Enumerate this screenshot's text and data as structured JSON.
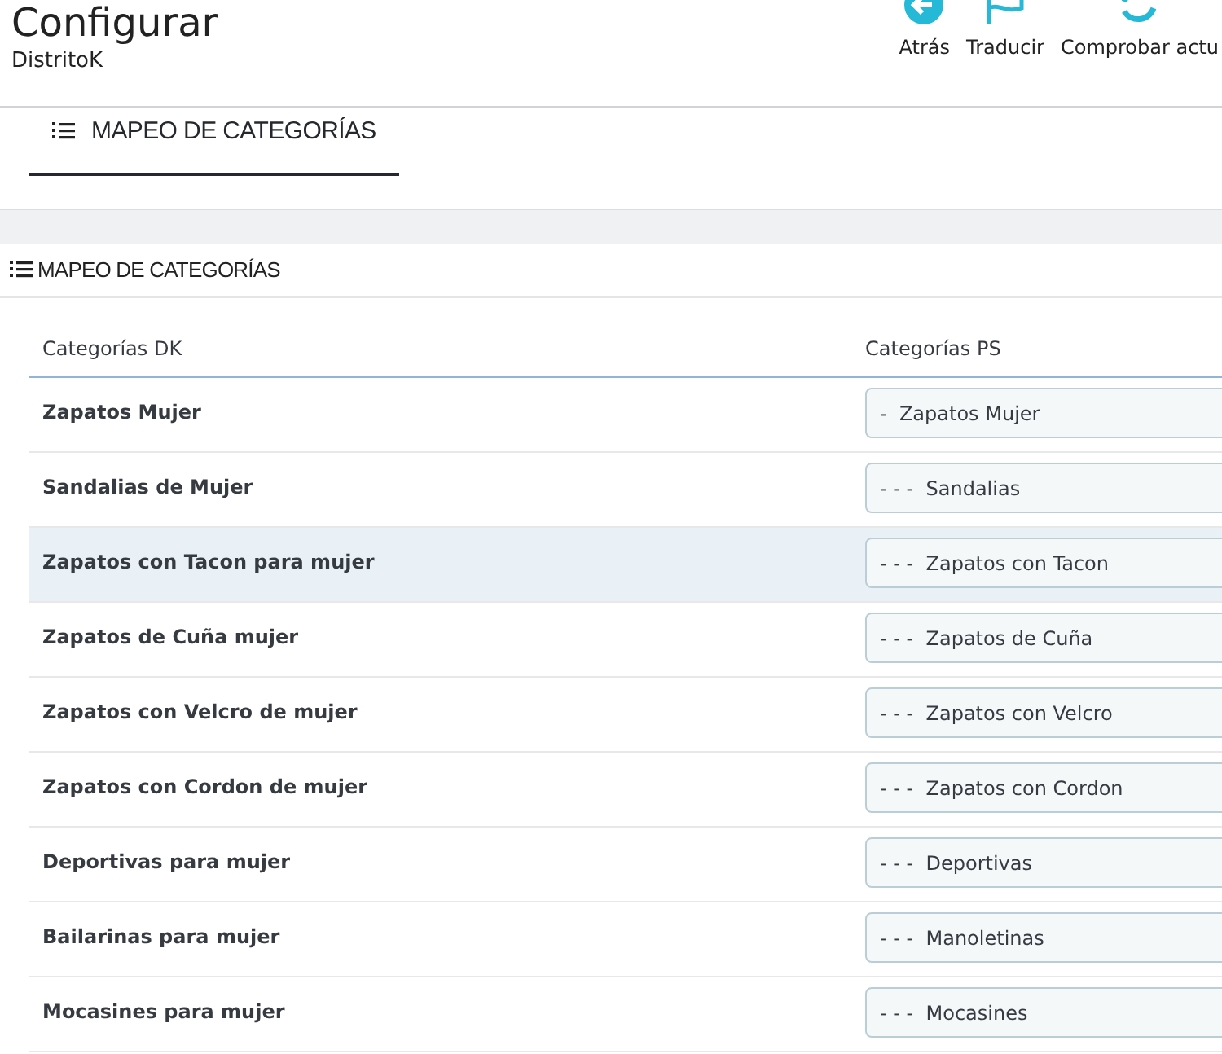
{
  "header": {
    "title": "Configurar",
    "subtitle": "DistritoK",
    "toolbar": [
      {
        "kind": "back",
        "label": "Atrás"
      },
      {
        "kind": "flag",
        "label": "Traducir"
      },
      {
        "kind": "refresh",
        "label": "Comprobar actu"
      }
    ]
  },
  "tabs": [
    {
      "label": "MAPEO DE CATEGORÍAS",
      "selected": true
    }
  ],
  "panel": {
    "heading": "MAPEO DE CATEGORÍAS",
    "columns": [
      "Categorías DK",
      "Categorías PS"
    ],
    "rows": [
      {
        "dk": "Zapatos Mujer",
        "ps": "-  Zapatos Mujer",
        "hovered": false
      },
      {
        "dk": "Sandalias de Mujer",
        "ps": "- - -  Sandalias",
        "hovered": false
      },
      {
        "dk": "Zapatos con Tacon para mujer",
        "ps": "- - -  Zapatos con Tacon",
        "hovered": true
      },
      {
        "dk": "Zapatos de Cuña mujer",
        "ps": "- - -  Zapatos de Cuña",
        "hovered": false
      },
      {
        "dk": "Zapatos con Velcro de mujer",
        "ps": "- - -  Zapatos con Velcro",
        "hovered": false
      },
      {
        "dk": "Zapatos con Cordon de mujer",
        "ps": "- - -  Zapatos con Cordon",
        "hovered": false
      },
      {
        "dk": "Deportivas para mujer",
        "ps": "- - -  Deportivas",
        "hovered": false
      },
      {
        "dk": "Bailarinas para mujer",
        "ps": "- - -  Manoletinas",
        "hovered": false
      },
      {
        "dk": "Mocasines para mujer",
        "ps": "- - -  Mocasines",
        "hovered": false
      }
    ]
  }
}
